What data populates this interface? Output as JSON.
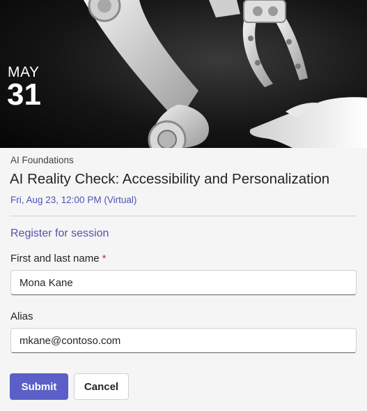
{
  "hero": {
    "image": "robot-arm-and-hand-image",
    "month": "MAY",
    "day": "31"
  },
  "event": {
    "category": "AI Foundations",
    "title": "AI Reality Check: Accessibility and Personalization",
    "datetime": "Fri, Aug 23, 12:00 PM (Virtual)"
  },
  "form": {
    "section_title": "Register for session",
    "name_label": "First and last name",
    "required_marker": "*",
    "name_value": "Mona Kane",
    "alias_label": "Alias",
    "alias_value": "mkane@contoso.com",
    "submit_label": "Submit",
    "cancel_label": "Cancel"
  },
  "colors": {
    "accent": "#5b5fc7",
    "link": "#4f52b2",
    "required": "#c4314b"
  }
}
